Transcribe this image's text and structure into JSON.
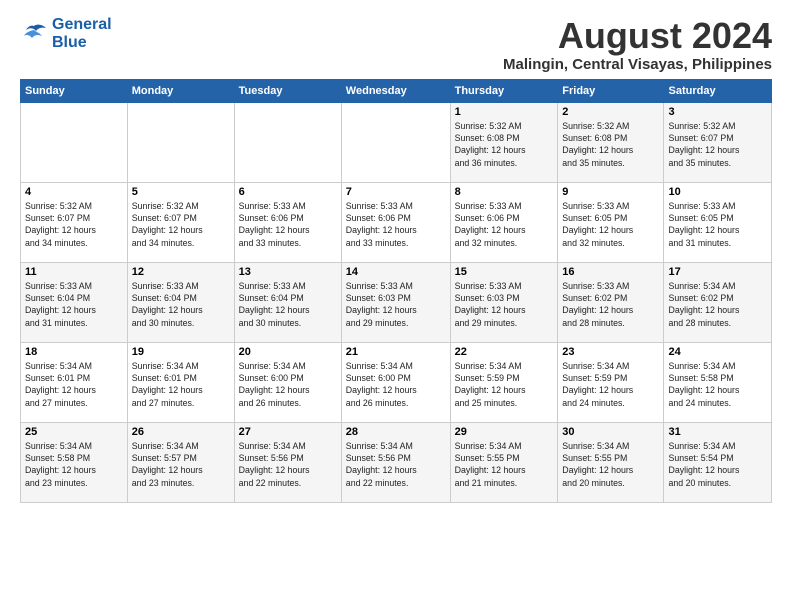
{
  "logo": {
    "line1": "General",
    "line2": "Blue"
  },
  "title": "August 2024",
  "subtitle": "Malingin, Central Visayas, Philippines",
  "days_of_week": [
    "Sunday",
    "Monday",
    "Tuesday",
    "Wednesday",
    "Thursday",
    "Friday",
    "Saturday"
  ],
  "weeks": [
    [
      {
        "day": "",
        "info": ""
      },
      {
        "day": "",
        "info": ""
      },
      {
        "day": "",
        "info": ""
      },
      {
        "day": "",
        "info": ""
      },
      {
        "day": "1",
        "info": "Sunrise: 5:32 AM\nSunset: 6:08 PM\nDaylight: 12 hours\nand 36 minutes."
      },
      {
        "day": "2",
        "info": "Sunrise: 5:32 AM\nSunset: 6:08 PM\nDaylight: 12 hours\nand 35 minutes."
      },
      {
        "day": "3",
        "info": "Sunrise: 5:32 AM\nSunset: 6:07 PM\nDaylight: 12 hours\nand 35 minutes."
      }
    ],
    [
      {
        "day": "4",
        "info": "Sunrise: 5:32 AM\nSunset: 6:07 PM\nDaylight: 12 hours\nand 34 minutes."
      },
      {
        "day": "5",
        "info": "Sunrise: 5:32 AM\nSunset: 6:07 PM\nDaylight: 12 hours\nand 34 minutes."
      },
      {
        "day": "6",
        "info": "Sunrise: 5:33 AM\nSunset: 6:06 PM\nDaylight: 12 hours\nand 33 minutes."
      },
      {
        "day": "7",
        "info": "Sunrise: 5:33 AM\nSunset: 6:06 PM\nDaylight: 12 hours\nand 33 minutes."
      },
      {
        "day": "8",
        "info": "Sunrise: 5:33 AM\nSunset: 6:06 PM\nDaylight: 12 hours\nand 32 minutes."
      },
      {
        "day": "9",
        "info": "Sunrise: 5:33 AM\nSunset: 6:05 PM\nDaylight: 12 hours\nand 32 minutes."
      },
      {
        "day": "10",
        "info": "Sunrise: 5:33 AM\nSunset: 6:05 PM\nDaylight: 12 hours\nand 31 minutes."
      }
    ],
    [
      {
        "day": "11",
        "info": "Sunrise: 5:33 AM\nSunset: 6:04 PM\nDaylight: 12 hours\nand 31 minutes."
      },
      {
        "day": "12",
        "info": "Sunrise: 5:33 AM\nSunset: 6:04 PM\nDaylight: 12 hours\nand 30 minutes."
      },
      {
        "day": "13",
        "info": "Sunrise: 5:33 AM\nSunset: 6:04 PM\nDaylight: 12 hours\nand 30 minutes."
      },
      {
        "day": "14",
        "info": "Sunrise: 5:33 AM\nSunset: 6:03 PM\nDaylight: 12 hours\nand 29 minutes."
      },
      {
        "day": "15",
        "info": "Sunrise: 5:33 AM\nSunset: 6:03 PM\nDaylight: 12 hours\nand 29 minutes."
      },
      {
        "day": "16",
        "info": "Sunrise: 5:33 AM\nSunset: 6:02 PM\nDaylight: 12 hours\nand 28 minutes."
      },
      {
        "day": "17",
        "info": "Sunrise: 5:34 AM\nSunset: 6:02 PM\nDaylight: 12 hours\nand 28 minutes."
      }
    ],
    [
      {
        "day": "18",
        "info": "Sunrise: 5:34 AM\nSunset: 6:01 PM\nDaylight: 12 hours\nand 27 minutes."
      },
      {
        "day": "19",
        "info": "Sunrise: 5:34 AM\nSunset: 6:01 PM\nDaylight: 12 hours\nand 27 minutes."
      },
      {
        "day": "20",
        "info": "Sunrise: 5:34 AM\nSunset: 6:00 PM\nDaylight: 12 hours\nand 26 minutes."
      },
      {
        "day": "21",
        "info": "Sunrise: 5:34 AM\nSunset: 6:00 PM\nDaylight: 12 hours\nand 26 minutes."
      },
      {
        "day": "22",
        "info": "Sunrise: 5:34 AM\nSunset: 5:59 PM\nDaylight: 12 hours\nand 25 minutes."
      },
      {
        "day": "23",
        "info": "Sunrise: 5:34 AM\nSunset: 5:59 PM\nDaylight: 12 hours\nand 24 minutes."
      },
      {
        "day": "24",
        "info": "Sunrise: 5:34 AM\nSunset: 5:58 PM\nDaylight: 12 hours\nand 24 minutes."
      }
    ],
    [
      {
        "day": "25",
        "info": "Sunrise: 5:34 AM\nSunset: 5:58 PM\nDaylight: 12 hours\nand 23 minutes."
      },
      {
        "day": "26",
        "info": "Sunrise: 5:34 AM\nSunset: 5:57 PM\nDaylight: 12 hours\nand 23 minutes."
      },
      {
        "day": "27",
        "info": "Sunrise: 5:34 AM\nSunset: 5:56 PM\nDaylight: 12 hours\nand 22 minutes."
      },
      {
        "day": "28",
        "info": "Sunrise: 5:34 AM\nSunset: 5:56 PM\nDaylight: 12 hours\nand 22 minutes."
      },
      {
        "day": "29",
        "info": "Sunrise: 5:34 AM\nSunset: 5:55 PM\nDaylight: 12 hours\nand 21 minutes."
      },
      {
        "day": "30",
        "info": "Sunrise: 5:34 AM\nSunset: 5:55 PM\nDaylight: 12 hours\nand 20 minutes."
      },
      {
        "day": "31",
        "info": "Sunrise: 5:34 AM\nSunset: 5:54 PM\nDaylight: 12 hours\nand 20 minutes."
      }
    ]
  ]
}
